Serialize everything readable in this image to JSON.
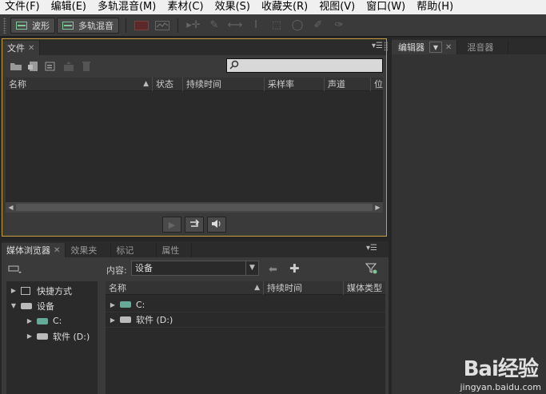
{
  "menubar": {
    "items": [
      "文件(F)",
      "编辑(E)",
      "多轨混音(M)",
      "素材(C)",
      "效果(S)",
      "收藏夹(R)",
      "视图(V)",
      "窗口(W)",
      "帮助(H)"
    ]
  },
  "toolbar": {
    "waveform_label": "波形",
    "multitrack_label": "多轨混音"
  },
  "files_panel": {
    "tab_label": "文件",
    "search_placeholder": "",
    "columns": [
      "名称",
      "状态",
      "持续时间",
      "采样率",
      "声道",
      "位"
    ]
  },
  "media_panel": {
    "tabs": [
      "媒体浏览器",
      "效果夹",
      "标记",
      "属性"
    ],
    "content_label": "内容:",
    "content_value": "设备",
    "tree": [
      {
        "label": "快捷方式",
        "expanded": false,
        "indent": 0
      },
      {
        "label": "设备",
        "expanded": true,
        "indent": 0
      },
      {
        "label": "C:",
        "expanded": false,
        "indent": 1
      },
      {
        "label": "软件 (D:)",
        "expanded": false,
        "indent": 1
      }
    ],
    "columns": [
      "名称",
      "持续时间",
      "媒体类型"
    ],
    "rows": [
      {
        "label": "C:"
      },
      {
        "label": "软件 (D:)"
      }
    ]
  },
  "editor_panel": {
    "tabs": [
      "编辑器",
      "混音器"
    ]
  },
  "watermark": {
    "logo": "Bai经验",
    "url": "jingyan.baidu.com"
  }
}
